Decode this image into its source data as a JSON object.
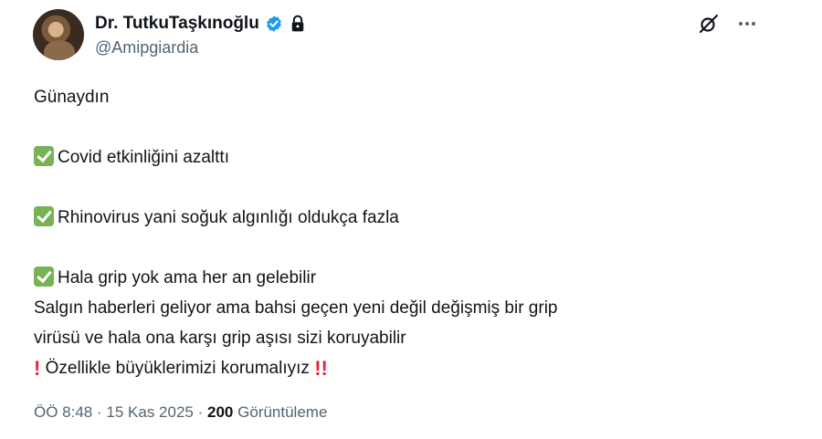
{
  "author": {
    "display_name": "Dr. TutkuTaşkınoğlu",
    "handle": "@Amipgiardia"
  },
  "icons": {
    "verified": "verified-badge-icon",
    "lock": "lock-icon",
    "grok": "grok-icon",
    "more": "more-icon",
    "check": "check-mark-emoji",
    "exclamation": "red-exclamation-emoji"
  },
  "colors": {
    "verified": "#1d9bf0",
    "check": "#77b255",
    "exclamation": "#e0243a",
    "secondary_text": "#536471"
  },
  "tweet": {
    "greeting": "Günaydın",
    "point1": "Covid etkinliğini azalttı",
    "point2": "Rhinovirus yani soğuk algınlığı oldukça fazla",
    "point3": "Hala grip yok ama her an gelebilir",
    "line4": "Salgın haberleri geliyor ama bahsi geçen yeni değil değişmiş bir grip",
    "line5": "virüsü ve hala ona karşı grip aşısı sizi koruyabilir",
    "warning": "Özellikle büyüklerimizi korumalıyız"
  },
  "meta": {
    "time": "ÖÖ 8:48",
    "separator": "·",
    "date": "15 Kas 2025",
    "views_count": "200",
    "views_label": "Görüntüleme"
  }
}
